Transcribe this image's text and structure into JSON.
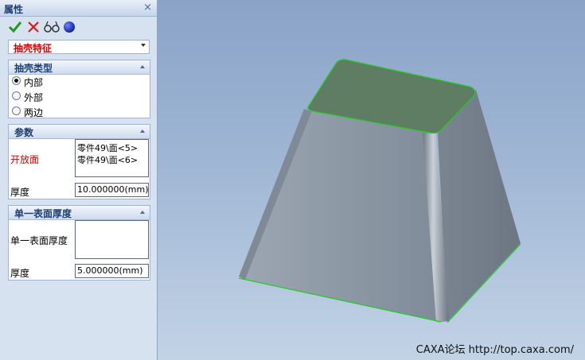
{
  "panel": {
    "title": "属性",
    "close_glyph": "×",
    "toolbar": {
      "ok_icon": "check-icon",
      "cancel_icon": "cross-icon",
      "preview_icon": "glasses-icon",
      "sphere_icon": "blue-sphere-icon"
    },
    "feature_select": {
      "value": "抽壳特征"
    },
    "shell_type": {
      "header": "抽壳类型",
      "options": [
        {
          "label": "内部",
          "selected": true
        },
        {
          "label": "外部",
          "selected": false
        },
        {
          "label": "两边",
          "selected": false
        }
      ]
    },
    "params": {
      "header": "参数",
      "open_face_label": "开放面",
      "open_faces": [
        "零件49\\面<5>",
        "零件49\\面<6>"
      ],
      "thickness_label": "厚度",
      "thickness_value": "10.000000(mm)"
    },
    "single_surface": {
      "header": "单一表面厚度",
      "surface_label": "单一表面厚度",
      "thickness_label": "厚度",
      "thickness_value": "5.000000(mm)"
    }
  },
  "viewport": {
    "watermark": "CAXA论坛 http://top.caxa.com/",
    "colors": {
      "body": "#8a96a4",
      "top_face": "#5f7d62",
      "edge_highlight": "#22cc22"
    }
  }
}
